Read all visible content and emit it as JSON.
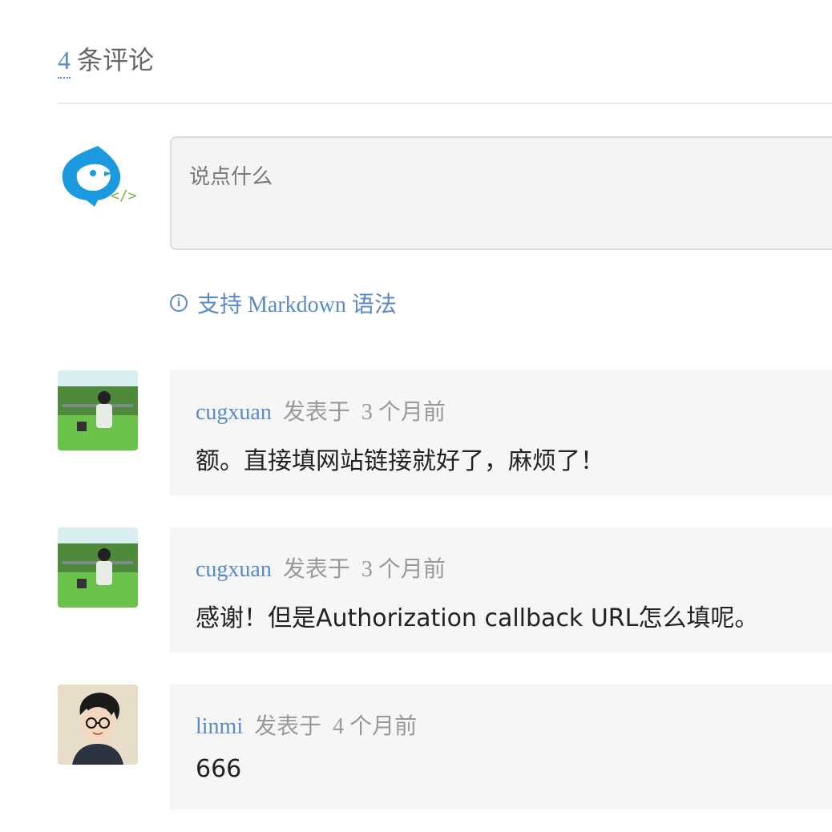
{
  "header": {
    "count": "4",
    "label": "条评论"
  },
  "editor": {
    "placeholder": "说点什么",
    "markdown_hint": "支持 Markdown 语法"
  },
  "comments": [
    {
      "author": "cugxuan",
      "posted_label": "发表于",
      "time": "3 个月前",
      "text": "额。直接填网站链接就好了，麻烦了！"
    },
    {
      "author": "cugxuan",
      "posted_label": "发表于",
      "time": "3 个月前",
      "text": "感谢！但是Authorization callback URL怎么填呢。"
    },
    {
      "author": "linmi",
      "posted_label": "发表于",
      "time": "4 个月前",
      "text": "666"
    }
  ],
  "colors": {
    "accent": "#5a8ac6",
    "bird_blue": "#1b9ae0",
    "code_green": "#7cb342"
  },
  "icons": {
    "self_avatar": "bird-code-logo-icon",
    "info": "info-circle-icon"
  }
}
